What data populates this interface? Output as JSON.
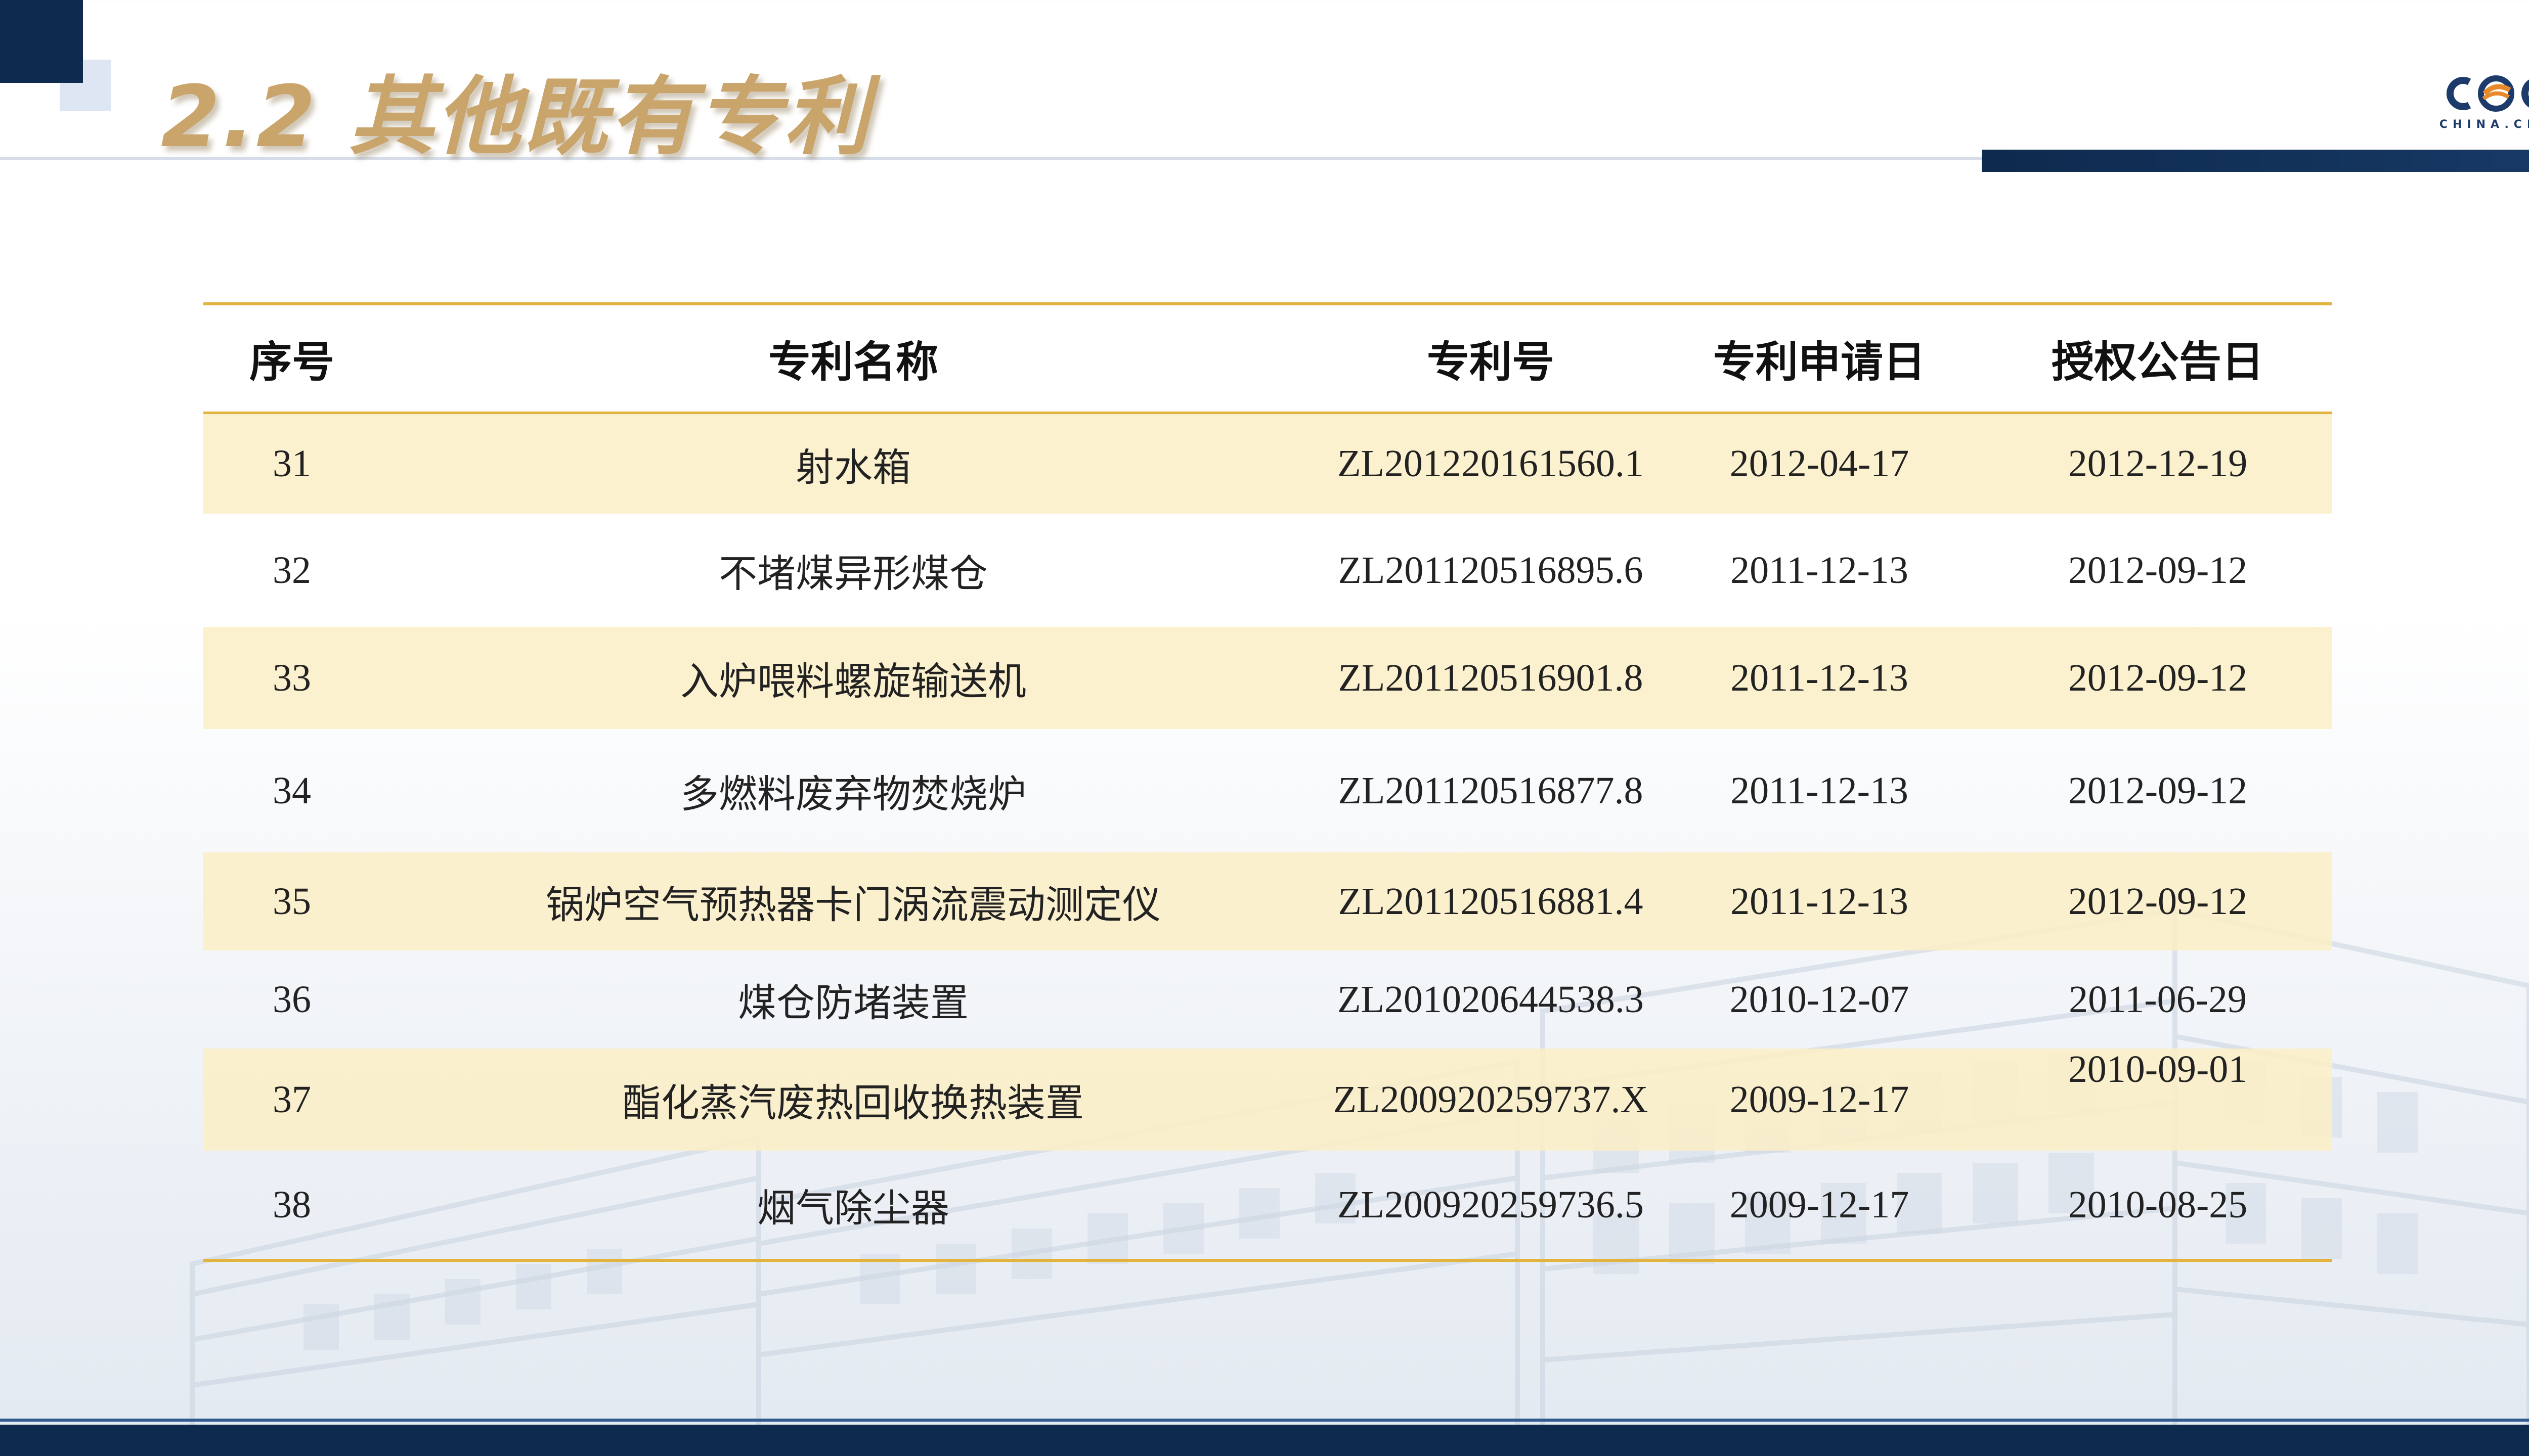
{
  "slide": {
    "title": "2.2 其他既有专利"
  },
  "logo": {
    "text": "CHINA.CEC"
  },
  "table": {
    "headers": [
      "序号",
      "专利名称",
      "专利号",
      "专利申请日",
      "授权公告日"
    ],
    "rows": [
      [
        "31",
        "射水箱",
        "ZL201220161560.1",
        "2012-04-17",
        "2012-12-19"
      ],
      [
        "32",
        "不堵煤异形煤仓",
        "ZL201120516895.6",
        "2011-12-13",
        "2012-09-12"
      ],
      [
        "33",
        "入炉喂料螺旋输送机",
        "ZL201120516901.8",
        "2011-12-13",
        "2012-09-12"
      ],
      [
        "34",
        "多燃料废弃物焚烧炉",
        "ZL201120516877.8",
        "2011-12-13",
        "2012-09-12"
      ],
      [
        "35",
        "锅炉空气预热器卡门涡流震动测定仪",
        "ZL201120516881.4",
        "2011-12-13",
        "2012-09-12"
      ],
      [
        "36",
        "煤仓防堵装置",
        "ZL201020644538.3",
        "2010-12-07",
        "2011-06-29"
      ],
      [
        "37",
        "酯化蒸汽废热回收换热装置",
        "ZL200920259737.X",
        "2009-12-17",
        "2010-09-01"
      ],
      [
        "38",
        "烟气除尘器",
        "ZL200920259736.5",
        "2009-12-17",
        "2010-08-25"
      ]
    ]
  },
  "colors": {
    "title": "#c9a46b",
    "navy": "#0e2a4e",
    "rule": "#e4b33e",
    "row_highlight": "#fcefc6"
  }
}
